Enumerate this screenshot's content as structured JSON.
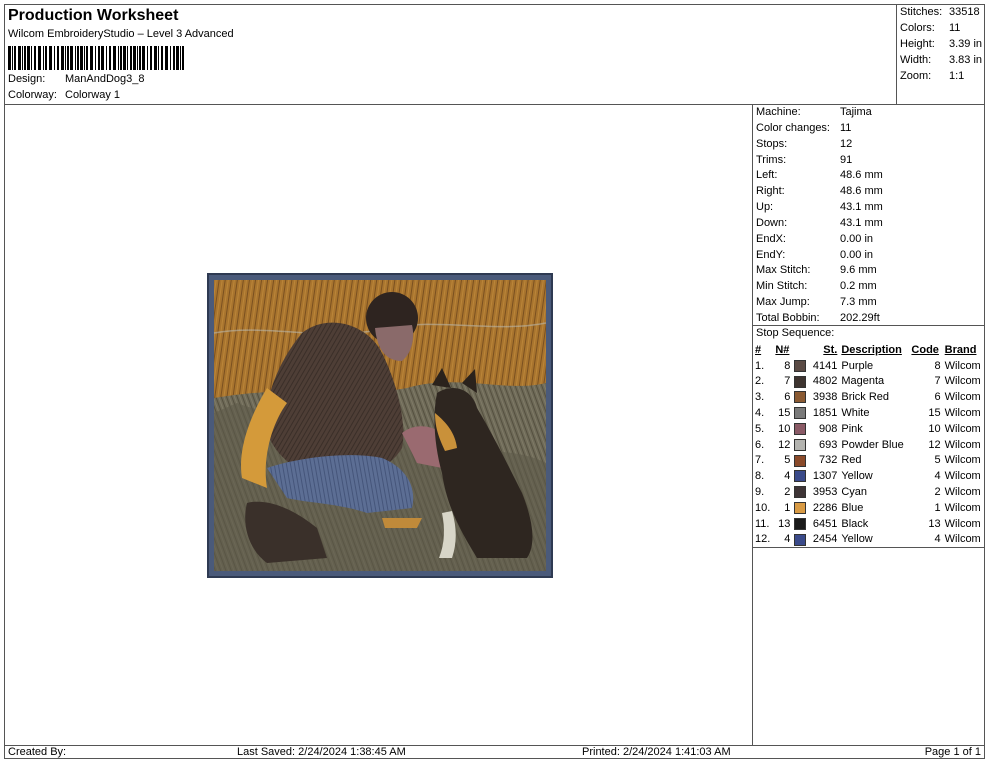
{
  "header": {
    "title": "Production Worksheet",
    "subtitle": "Wilcom EmbroideryStudio – Level 3 Advanced",
    "design_label": "Design:",
    "design_value": "ManAndDog3_8",
    "colorway_label": "Colorway:",
    "colorway_value": "Colorway 1"
  },
  "stats": [
    {
      "label": "Stitches:",
      "value": "33518"
    },
    {
      "label": "Colors:",
      "value": "11"
    },
    {
      "label": "Height:",
      "value": "3.39 in"
    },
    {
      "label": "Width:",
      "value": "3.83 in"
    },
    {
      "label": "Zoom:",
      "value": "1:1"
    }
  ],
  "properties": [
    {
      "label": "Machine:",
      "value": "Tajima"
    },
    {
      "label": "Color changes:",
      "value": "11"
    },
    {
      "label": "Stops:",
      "value": "12"
    },
    {
      "label": "Trims:",
      "value": "91"
    },
    {
      "label": "Left:",
      "value": "48.6 mm"
    },
    {
      "label": "Right:",
      "value": "48.6 mm"
    },
    {
      "label": "Up:",
      "value": "43.1 mm"
    },
    {
      "label": "Down:",
      "value": "43.1 mm"
    },
    {
      "label": "EndX:",
      "value": "0.00 in"
    },
    {
      "label": "EndY:",
      "value": "0.00 in"
    },
    {
      "label": "Max Stitch:",
      "value": "9.6 mm"
    },
    {
      "label": "Min Stitch:",
      "value": "0.2 mm"
    },
    {
      "label": "Max Jump:",
      "value": "7.3 mm"
    },
    {
      "label": "Total Bobbin:",
      "value": "202.29ft"
    }
  ],
  "stop_sequence": {
    "title": "Stop Sequence:",
    "headers": {
      "num": "#",
      "n": "N#",
      "st": "St.",
      "description": "Description",
      "code": "Code",
      "brand": "Brand"
    },
    "rows": [
      {
        "num": "1.",
        "n": "8",
        "color": "#5a4a44",
        "st": "4141",
        "description": "Purple",
        "code": "8",
        "brand": "Wilcom"
      },
      {
        "num": "2.",
        "n": "7",
        "color": "#3e3430",
        "st": "4802",
        "description": "Magenta",
        "code": "7",
        "brand": "Wilcom"
      },
      {
        "num": "3.",
        "n": "6",
        "color": "#8a5a32",
        "st": "3938",
        "description": "Brick Red",
        "code": "6",
        "brand": "Wilcom"
      },
      {
        "num": "4.",
        "n": "15",
        "color": "#7a7a7a",
        "st": "1851",
        "description": "White",
        "code": "15",
        "brand": "Wilcom"
      },
      {
        "num": "5.",
        "n": "10",
        "color": "#8a5a66",
        "st": "908",
        "description": "Pink",
        "code": "10",
        "brand": "Wilcom"
      },
      {
        "num": "6.",
        "n": "12",
        "color": "#b4b4b0",
        "st": "693",
        "description": "Powder Blue",
        "code": "12",
        "brand": "Wilcom"
      },
      {
        "num": "7.",
        "n": "5",
        "color": "#8a4a2a",
        "st": "732",
        "description": "Red",
        "code": "5",
        "brand": "Wilcom"
      },
      {
        "num": "8.",
        "n": "4",
        "color": "#3a4a8a",
        "st": "1307",
        "description": "Yellow",
        "code": "4",
        "brand": "Wilcom"
      },
      {
        "num": "9.",
        "n": "2",
        "color": "#3e3436",
        "st": "3953",
        "description": "Cyan",
        "code": "2",
        "brand": "Wilcom"
      },
      {
        "num": "10.",
        "n": "1",
        "color": "#d89a44",
        "st": "2286",
        "description": "Blue",
        "code": "1",
        "brand": "Wilcom"
      },
      {
        "num": "11.",
        "n": "13",
        "color": "#1a1a1a",
        "st": "6451",
        "description": "Black",
        "code": "13",
        "brand": "Wilcom"
      },
      {
        "num": "12.",
        "n": "4",
        "color": "#3a4a8a",
        "st": "2454",
        "description": "Yellow",
        "code": "4",
        "brand": "Wilcom"
      }
    ]
  },
  "footer": {
    "created_by": "Created By:",
    "last_saved": "Last Saved: 2/24/2024 1:38:45 AM",
    "printed": "Printed: 2/24/2024 1:41:03 AM",
    "page": "Page 1 of 1"
  }
}
